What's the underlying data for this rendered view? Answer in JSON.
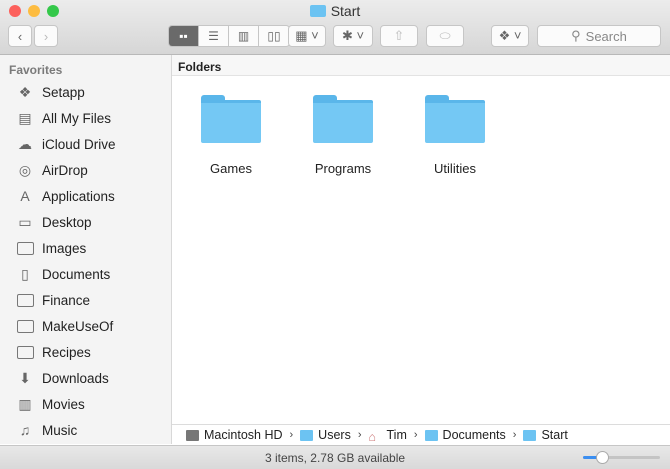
{
  "window": {
    "title": "Start"
  },
  "toolbar": {
    "search_placeholder": "Search"
  },
  "sidebar": {
    "heading": "Favorites",
    "items": [
      {
        "label": "Setapp",
        "icon": "setapp-icon"
      },
      {
        "label": "All My Files",
        "icon": "all-files-icon"
      },
      {
        "label": "iCloud Drive",
        "icon": "cloud-icon"
      },
      {
        "label": "AirDrop",
        "icon": "airdrop-icon"
      },
      {
        "label": "Applications",
        "icon": "applications-icon"
      },
      {
        "label": "Desktop",
        "icon": "desktop-icon"
      },
      {
        "label": "Images",
        "icon": "folder-icon"
      },
      {
        "label": "Documents",
        "icon": "document-icon"
      },
      {
        "label": "Finance",
        "icon": "folder-icon"
      },
      {
        "label": "MakeUseOf",
        "icon": "folder-icon"
      },
      {
        "label": "Recipes",
        "icon": "folder-icon"
      },
      {
        "label": "Downloads",
        "icon": "download-icon"
      },
      {
        "label": "Movies",
        "icon": "film-icon"
      },
      {
        "label": "Music",
        "icon": "music-icon"
      }
    ]
  },
  "main": {
    "section": "Folders",
    "folders": [
      "Games",
      "Programs",
      "Utilities"
    ]
  },
  "path": [
    "Macintosh HD",
    "Users",
    "Tim",
    "Documents",
    "Start"
  ],
  "status": {
    "text": "3 items, 2.78 GB available",
    "zoom_level": 0.25
  }
}
